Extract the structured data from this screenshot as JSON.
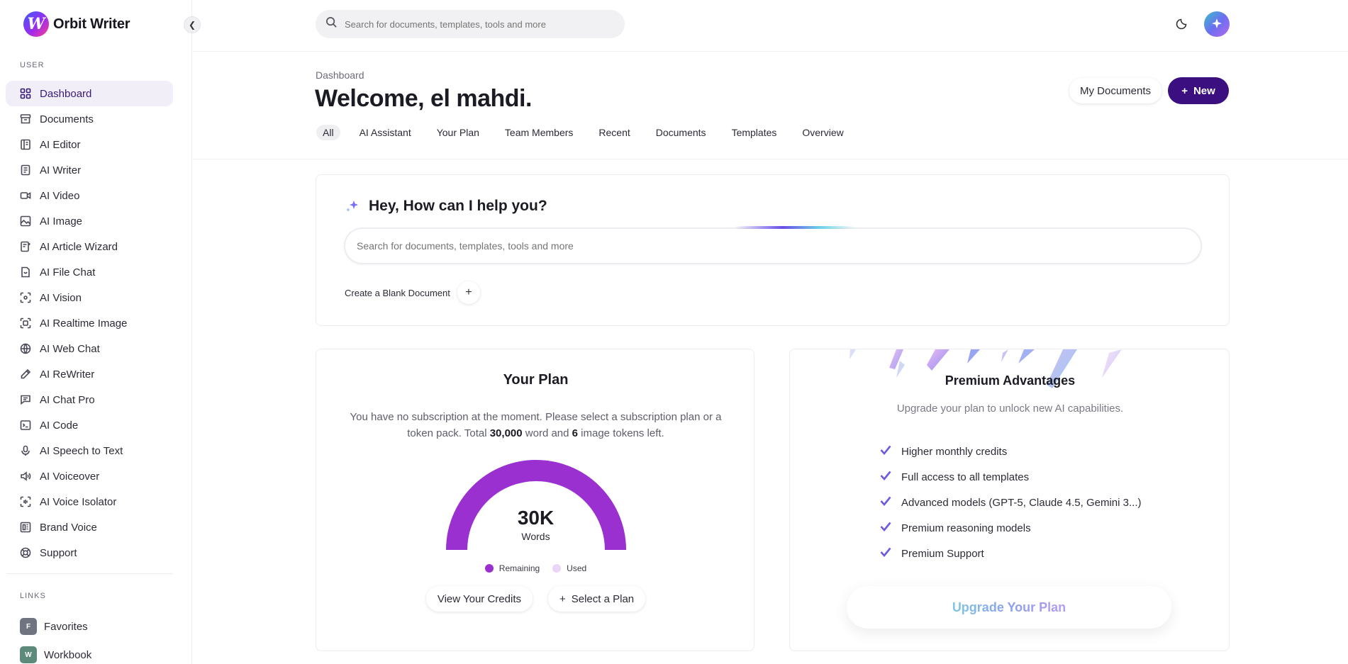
{
  "app": {
    "name": "Orbit Writer",
    "logo_letter": "W",
    "accent": "#3b0f80",
    "brand_purple": "#9b30d0"
  },
  "sidebar": {
    "user_section": "USER",
    "links_section": "LINKS",
    "items": [
      {
        "label": "Dashboard",
        "icon": "grid-icon",
        "active": true
      },
      {
        "label": "Documents",
        "icon": "archive-icon"
      },
      {
        "label": "AI Editor",
        "icon": "editor-icon"
      },
      {
        "label": "AI Writer",
        "icon": "file-text-icon"
      },
      {
        "label": "AI Video",
        "icon": "video-icon"
      },
      {
        "label": "AI Image",
        "icon": "image-icon"
      },
      {
        "label": "AI Article Wizard",
        "icon": "article-icon"
      },
      {
        "label": "AI File Chat",
        "icon": "file-chat-icon"
      },
      {
        "label": "AI Vision",
        "icon": "scan-eye-icon"
      },
      {
        "label": "AI Realtime Image",
        "icon": "realtime-image-icon"
      },
      {
        "label": "AI Web Chat",
        "icon": "globe-icon"
      },
      {
        "label": "AI ReWriter",
        "icon": "pencil-icon"
      },
      {
        "label": "AI Chat Pro",
        "icon": "chat-icon"
      },
      {
        "label": "AI Code",
        "icon": "terminal-icon"
      },
      {
        "label": "AI Speech to Text",
        "icon": "microphone-icon"
      },
      {
        "label": "AI Voiceover",
        "icon": "speaker-icon"
      },
      {
        "label": "AI Voice Isolator",
        "icon": "voice-isolator-icon"
      },
      {
        "label": "Brand Voice",
        "icon": "brand-icon"
      },
      {
        "label": "Support",
        "icon": "lifebuoy-icon"
      }
    ],
    "links": [
      {
        "label": "Favorites",
        "badge": "F",
        "color": "#6f7480"
      },
      {
        "label": "Workbook",
        "badge": "W",
        "color": "#5e8a7c"
      }
    ]
  },
  "topbar": {
    "search_placeholder": "Search for documents, templates, tools and more"
  },
  "header": {
    "breadcrumb": "Dashboard",
    "title": "Welcome, el mahdi.",
    "my_documents": "My Documents",
    "new_label": "New",
    "tabs": [
      "All",
      "AI Assistant",
      "Your Plan",
      "Team Members",
      "Recent",
      "Documents",
      "Templates",
      "Overview"
    ]
  },
  "assistant": {
    "title": "Hey, How can I help you?",
    "search_placeholder": "Search for documents, templates, tools and more",
    "blank_doc": "Create a Blank Document"
  },
  "plan": {
    "title": "Your Plan",
    "desc_part1": "You have no subscription at the moment. Please select a subscription plan or a token pack. Total ",
    "words_total": "30,000",
    "desc_part2": " word and ",
    "image_tokens": "6",
    "desc_part3": " image tokens left.",
    "gauge_value": "30K",
    "gauge_unit": "Words",
    "remaining_fraction": 1.0,
    "legend_remaining": "Remaining",
    "legend_used": "Used",
    "color_remaining": "#9b30d0",
    "color_used": "#ead6f7",
    "view_credits": "View Your Credits",
    "select_plan": "Select a Plan"
  },
  "premium": {
    "title": "Premium Advantages",
    "subtitle": "Upgrade your plan to unlock new AI capabilities.",
    "features": [
      "Higher monthly credits",
      "Full access to all templates",
      "Advanced models (GPT-5, Claude 4.5, Gemini 3...)",
      "Premium reasoning models",
      "Premium Support"
    ],
    "upgrade_label": "Upgrade Your Plan"
  }
}
